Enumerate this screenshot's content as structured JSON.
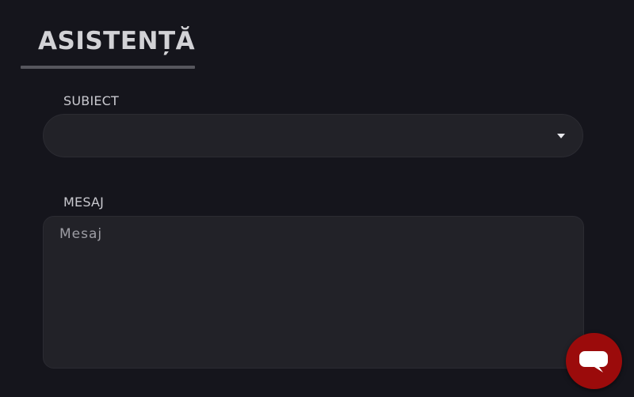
{
  "page": {
    "title": "ASISTENȚĂ"
  },
  "form": {
    "subject": {
      "label": "SUBIECT",
      "value": ""
    },
    "message": {
      "label": "MESAJ",
      "placeholder": "Mesaj",
      "value": ""
    }
  },
  "chat_widget": {
    "icon": "chat-bubble-icon",
    "color": "#9b0b0b"
  },
  "colors": {
    "background": "#15151c",
    "field_background": "#222228",
    "accent": "#9b0b0b"
  }
}
